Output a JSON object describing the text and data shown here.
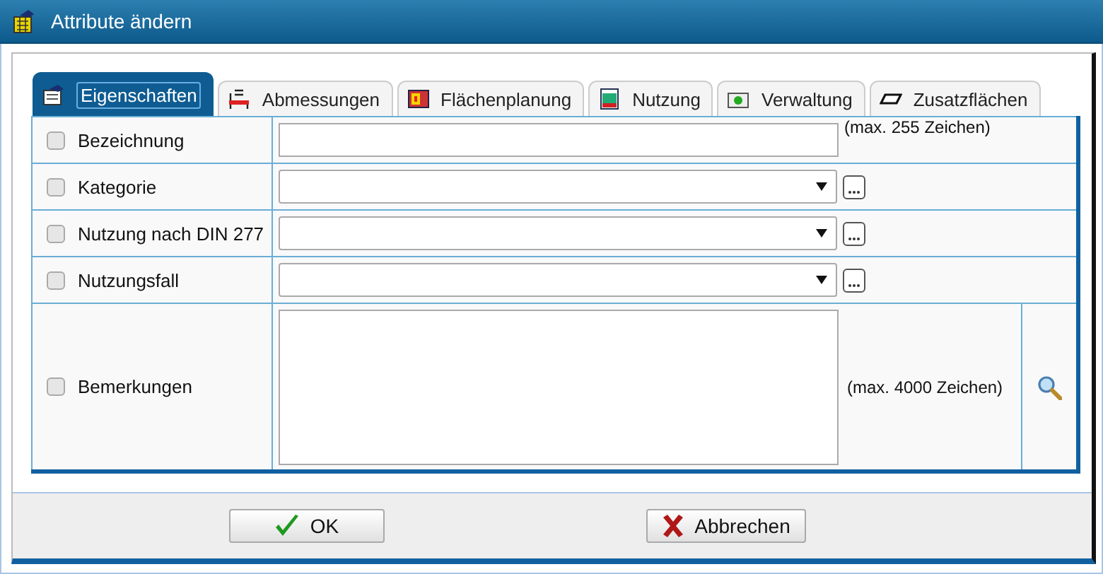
{
  "window": {
    "title": "Attribute ändern"
  },
  "tabs": [
    {
      "label": "Eigenschaften",
      "selected": true,
      "kind": "properties"
    },
    {
      "label": "Abmessungen",
      "selected": false,
      "kind": "dimensions"
    },
    {
      "label": "Flächenplanung",
      "selected": false,
      "kind": "planning"
    },
    {
      "label": "Nutzung",
      "selected": false,
      "kind": "usage"
    },
    {
      "label": "Verwaltung",
      "selected": false,
      "kind": "admin"
    },
    {
      "label": "Zusatzflächen",
      "selected": false,
      "kind": "extra"
    }
  ],
  "rows": [
    {
      "label": "Bezeichnung",
      "checked": false,
      "kind": "text",
      "hint": "(max. 255 Zeichen)"
    },
    {
      "label": "Kategorie",
      "checked": false,
      "kind": "select"
    },
    {
      "label": "Nutzung nach DIN 277",
      "checked": false,
      "kind": "select"
    },
    {
      "label": "Nutzungsfall",
      "checked": false,
      "kind": "select"
    },
    {
      "label": "Bemerkungen",
      "checked": false,
      "kind": "textarea",
      "hint": "(max. 4000 Zeichen)"
    }
  ],
  "buttons": [
    {
      "label": "OK",
      "kind": "ok"
    },
    {
      "label": "Abbrechen",
      "kind": "cancel"
    }
  ]
}
